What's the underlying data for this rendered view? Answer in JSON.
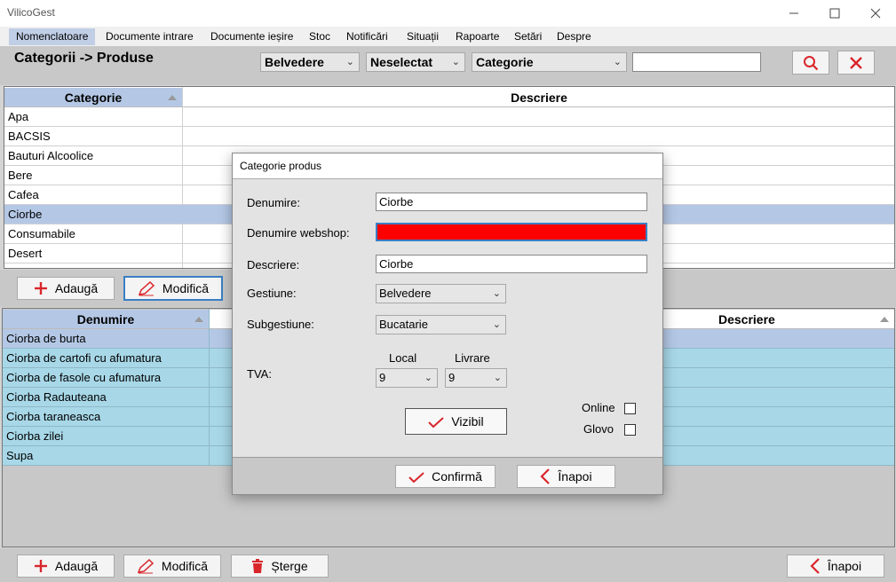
{
  "window": {
    "title": "VilicoGest"
  },
  "menu": [
    "Nomenclatoare",
    "Documente intrare",
    "Documente ieșire",
    "Stoc",
    "Notificări",
    "Situații",
    "Rapoarte",
    "Setări",
    "Despre"
  ],
  "header": {
    "title": "Categorii -> Produse",
    "gestiune": "Belvedere",
    "subgestiune": "Neselectat",
    "filter_field": "Categorie",
    "search_value": ""
  },
  "categories_grid": {
    "columns": [
      "Categorie",
      "Descriere"
    ],
    "rows": [
      "Apa",
      "BACSIS",
      "Bauturi Alcoolice",
      "Bere",
      "Cafea",
      "Ciorbe",
      "Consumabile",
      "Desert"
    ],
    "selected": "Ciorbe"
  },
  "toolbar_top": {
    "add": "Adaugă",
    "edit": "Modifică"
  },
  "products_grid": {
    "columns": [
      "Denumire",
      "Descriere"
    ],
    "rows": [
      "Ciorba de burta",
      "Ciorba de cartofi cu afumatura",
      "Ciorba de fasole cu afumatura",
      "Ciorba Radauteana",
      "Ciorba taraneasca",
      "Ciorba zilei",
      "Supa"
    ]
  },
  "toolbar_bottom": {
    "add": "Adaugă",
    "edit": "Modifică",
    "delete": "Șterge",
    "back": "Înapoi"
  },
  "dialog": {
    "title": "Categorie produs",
    "denumire_label": "Denumire:",
    "denumire_value": "Ciorbe",
    "webshop_label": "Denumire webshop:",
    "webshop_value": "",
    "descriere_label": "Descriere:",
    "descriere_value": "Ciorbe",
    "gestiune_label": "Gestiune:",
    "gestiune_value": "Belvedere",
    "subgestiune_label": "Subgestiune:",
    "subgestiune_value": "Bucatarie",
    "tva_label": "TVA:",
    "local_label": "Local",
    "local_value": "9",
    "livrare_label": "Livrare",
    "livrare_value": "9",
    "vizibil_label": "Vizibil",
    "online_label": "Online",
    "glovo_label": "Glovo",
    "confirm_label": "Confirmă",
    "back_label": "Înapoi"
  },
  "colors": {
    "selected_row": "#b4c8e6",
    "product_row": "#a8d8e8",
    "webshop_field": "#ff0000",
    "accent_red": "#d9262b"
  }
}
